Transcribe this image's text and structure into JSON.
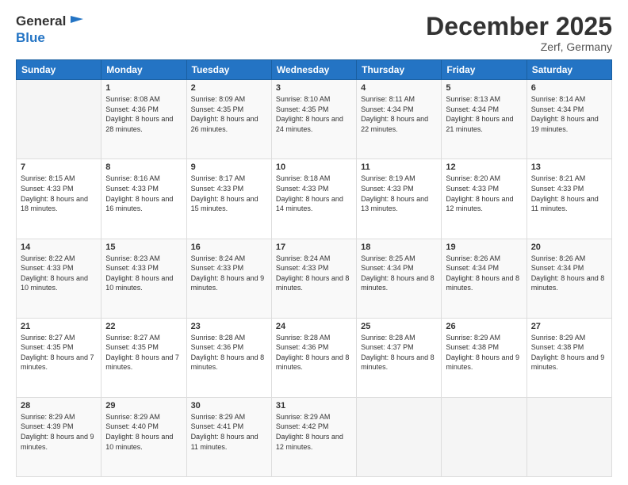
{
  "header": {
    "logo_line1": "General",
    "logo_line2": "Blue",
    "month_title": "December 2025",
    "location": "Zerf, Germany"
  },
  "weekdays": [
    "Sunday",
    "Monday",
    "Tuesday",
    "Wednesday",
    "Thursday",
    "Friday",
    "Saturday"
  ],
  "weeks": [
    [
      {
        "day": "",
        "sunrise": "",
        "sunset": "",
        "daylight": ""
      },
      {
        "day": "1",
        "sunrise": "Sunrise: 8:08 AM",
        "sunset": "Sunset: 4:36 PM",
        "daylight": "Daylight: 8 hours and 28 minutes."
      },
      {
        "day": "2",
        "sunrise": "Sunrise: 8:09 AM",
        "sunset": "Sunset: 4:35 PM",
        "daylight": "Daylight: 8 hours and 26 minutes."
      },
      {
        "day": "3",
        "sunrise": "Sunrise: 8:10 AM",
        "sunset": "Sunset: 4:35 PM",
        "daylight": "Daylight: 8 hours and 24 minutes."
      },
      {
        "day": "4",
        "sunrise": "Sunrise: 8:11 AM",
        "sunset": "Sunset: 4:34 PM",
        "daylight": "Daylight: 8 hours and 22 minutes."
      },
      {
        "day": "5",
        "sunrise": "Sunrise: 8:13 AM",
        "sunset": "Sunset: 4:34 PM",
        "daylight": "Daylight: 8 hours and 21 minutes."
      },
      {
        "day": "6",
        "sunrise": "Sunrise: 8:14 AM",
        "sunset": "Sunset: 4:34 PM",
        "daylight": "Daylight: 8 hours and 19 minutes."
      }
    ],
    [
      {
        "day": "7",
        "sunrise": "Sunrise: 8:15 AM",
        "sunset": "Sunset: 4:33 PM",
        "daylight": "Daylight: 8 hours and 18 minutes."
      },
      {
        "day": "8",
        "sunrise": "Sunrise: 8:16 AM",
        "sunset": "Sunset: 4:33 PM",
        "daylight": "Daylight: 8 hours and 16 minutes."
      },
      {
        "day": "9",
        "sunrise": "Sunrise: 8:17 AM",
        "sunset": "Sunset: 4:33 PM",
        "daylight": "Daylight: 8 hours and 15 minutes."
      },
      {
        "day": "10",
        "sunrise": "Sunrise: 8:18 AM",
        "sunset": "Sunset: 4:33 PM",
        "daylight": "Daylight: 8 hours and 14 minutes."
      },
      {
        "day": "11",
        "sunrise": "Sunrise: 8:19 AM",
        "sunset": "Sunset: 4:33 PM",
        "daylight": "Daylight: 8 hours and 13 minutes."
      },
      {
        "day": "12",
        "sunrise": "Sunrise: 8:20 AM",
        "sunset": "Sunset: 4:33 PM",
        "daylight": "Daylight: 8 hours and 12 minutes."
      },
      {
        "day": "13",
        "sunrise": "Sunrise: 8:21 AM",
        "sunset": "Sunset: 4:33 PM",
        "daylight": "Daylight: 8 hours and 11 minutes."
      }
    ],
    [
      {
        "day": "14",
        "sunrise": "Sunrise: 8:22 AM",
        "sunset": "Sunset: 4:33 PM",
        "daylight": "Daylight: 8 hours and 10 minutes."
      },
      {
        "day": "15",
        "sunrise": "Sunrise: 8:23 AM",
        "sunset": "Sunset: 4:33 PM",
        "daylight": "Daylight: 8 hours and 10 minutes."
      },
      {
        "day": "16",
        "sunrise": "Sunrise: 8:24 AM",
        "sunset": "Sunset: 4:33 PM",
        "daylight": "Daylight: 8 hours and 9 minutes."
      },
      {
        "day": "17",
        "sunrise": "Sunrise: 8:24 AM",
        "sunset": "Sunset: 4:33 PM",
        "daylight": "Daylight: 8 hours and 8 minutes."
      },
      {
        "day": "18",
        "sunrise": "Sunrise: 8:25 AM",
        "sunset": "Sunset: 4:34 PM",
        "daylight": "Daylight: 8 hours and 8 minutes."
      },
      {
        "day": "19",
        "sunrise": "Sunrise: 8:26 AM",
        "sunset": "Sunset: 4:34 PM",
        "daylight": "Daylight: 8 hours and 8 minutes."
      },
      {
        "day": "20",
        "sunrise": "Sunrise: 8:26 AM",
        "sunset": "Sunset: 4:34 PM",
        "daylight": "Daylight: 8 hours and 8 minutes."
      }
    ],
    [
      {
        "day": "21",
        "sunrise": "Sunrise: 8:27 AM",
        "sunset": "Sunset: 4:35 PM",
        "daylight": "Daylight: 8 hours and 7 minutes."
      },
      {
        "day": "22",
        "sunrise": "Sunrise: 8:27 AM",
        "sunset": "Sunset: 4:35 PM",
        "daylight": "Daylight: 8 hours and 7 minutes."
      },
      {
        "day": "23",
        "sunrise": "Sunrise: 8:28 AM",
        "sunset": "Sunset: 4:36 PM",
        "daylight": "Daylight: 8 hours and 8 minutes."
      },
      {
        "day": "24",
        "sunrise": "Sunrise: 8:28 AM",
        "sunset": "Sunset: 4:36 PM",
        "daylight": "Daylight: 8 hours and 8 minutes."
      },
      {
        "day": "25",
        "sunrise": "Sunrise: 8:28 AM",
        "sunset": "Sunset: 4:37 PM",
        "daylight": "Daylight: 8 hours and 8 minutes."
      },
      {
        "day": "26",
        "sunrise": "Sunrise: 8:29 AM",
        "sunset": "Sunset: 4:38 PM",
        "daylight": "Daylight: 8 hours and 9 minutes."
      },
      {
        "day": "27",
        "sunrise": "Sunrise: 8:29 AM",
        "sunset": "Sunset: 4:38 PM",
        "daylight": "Daylight: 8 hours and 9 minutes."
      }
    ],
    [
      {
        "day": "28",
        "sunrise": "Sunrise: 8:29 AM",
        "sunset": "Sunset: 4:39 PM",
        "daylight": "Daylight: 8 hours and 9 minutes."
      },
      {
        "day": "29",
        "sunrise": "Sunrise: 8:29 AM",
        "sunset": "Sunset: 4:40 PM",
        "daylight": "Daylight: 8 hours and 10 minutes."
      },
      {
        "day": "30",
        "sunrise": "Sunrise: 8:29 AM",
        "sunset": "Sunset: 4:41 PM",
        "daylight": "Daylight: 8 hours and 11 minutes."
      },
      {
        "day": "31",
        "sunrise": "Sunrise: 8:29 AM",
        "sunset": "Sunset: 4:42 PM",
        "daylight": "Daylight: 8 hours and 12 minutes."
      },
      {
        "day": "",
        "sunrise": "",
        "sunset": "",
        "daylight": ""
      },
      {
        "day": "",
        "sunrise": "",
        "sunset": "",
        "daylight": ""
      },
      {
        "day": "",
        "sunrise": "",
        "sunset": "",
        "daylight": ""
      }
    ]
  ]
}
